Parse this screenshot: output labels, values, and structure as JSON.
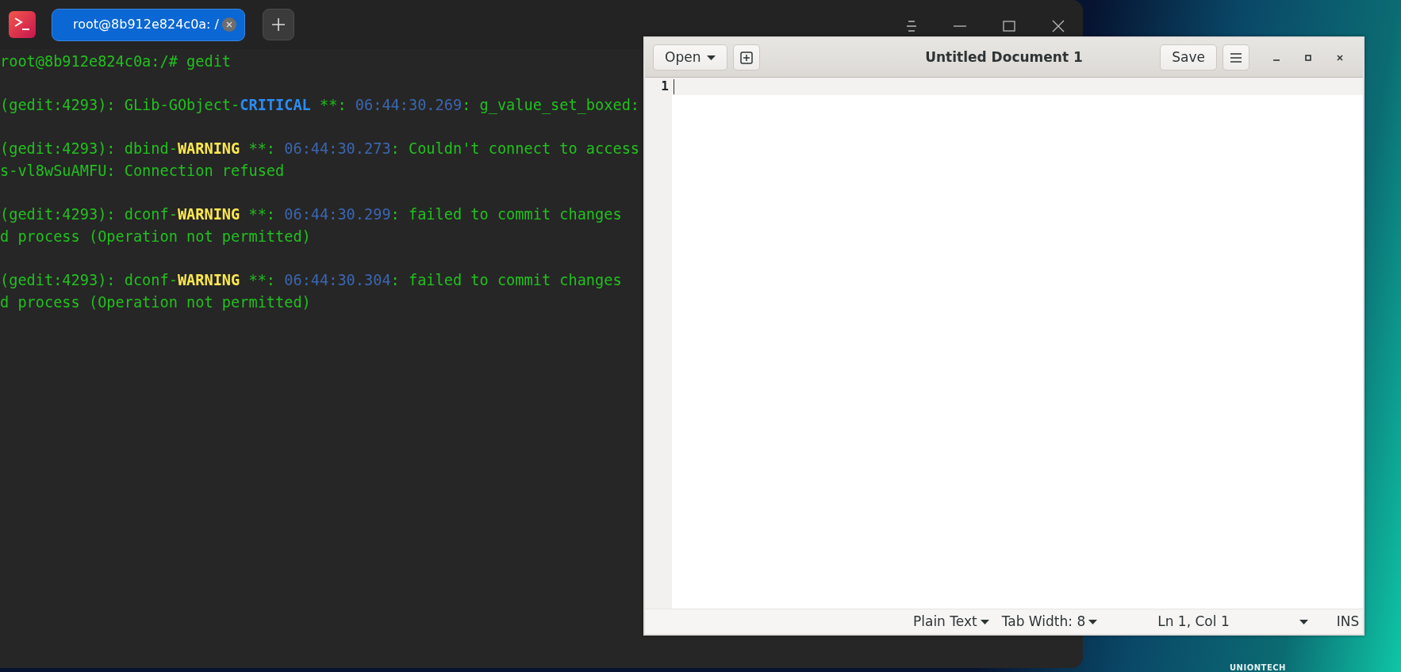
{
  "terminal": {
    "tab": {
      "label": "root@8b912e824c0a: /",
      "selected": true
    },
    "prompt": [
      {
        "text": "root@8b912e824c0a:/# gedit",
        "kind": "normal"
      }
    ],
    "messages": [
      {
        "lines": [
          [
            {
              "text": "(gedit:4293): GLib-GObject-",
              "kind": "normal"
            },
            {
              "text": "CRITICAL",
              "kind": "critical"
            },
            {
              "text": " **: ",
              "kind": "normal"
            },
            {
              "text": "06:44:30.269",
              "kind": "time"
            },
            {
              "text": ": g_value_set_boxed:",
              "kind": "normal"
            }
          ]
        ]
      },
      {
        "lines": [
          [
            {
              "text": "(gedit:4293): dbind-",
              "kind": "normal"
            },
            {
              "text": "WARNING",
              "kind": "warning"
            },
            {
              "text": " **: ",
              "kind": "normal"
            },
            {
              "text": "06:44:30.273",
              "kind": "time"
            },
            {
              "text": ": Couldn't connect to access",
              "kind": "normal"
            }
          ],
          [
            {
              "text": "s-vl8wSuAMFU: Connection refused",
              "kind": "normal"
            }
          ]
        ]
      },
      {
        "lines": [
          [
            {
              "text": "(gedit:4293): dconf-",
              "kind": "normal"
            },
            {
              "text": "WARNING",
              "kind": "warning"
            },
            {
              "text": " **: ",
              "kind": "normal"
            },
            {
              "text": "06:44:30.299",
              "kind": "time"
            },
            {
              "text": ": failed to commit changes",
              "kind": "normal"
            }
          ],
          [
            {
              "text": "d process (Operation not permitted)",
              "kind": "normal"
            }
          ]
        ]
      },
      {
        "lines": [
          [
            {
              "text": "(gedit:4293): dconf-",
              "kind": "normal"
            },
            {
              "text": "WARNING",
              "kind": "warning"
            },
            {
              "text": " **: ",
              "kind": "normal"
            },
            {
              "text": "06:44:30.304",
              "kind": "time"
            },
            {
              "text": ": failed to commit changes",
              "kind": "normal"
            }
          ],
          [
            {
              "text": "d process (Operation not permitted)",
              "kind": "normal"
            }
          ]
        ]
      }
    ]
  },
  "gedit": {
    "open_button": "Open",
    "title": "Untitled Document 1",
    "save_button": "Save",
    "line_numbers": [
      "1"
    ],
    "status_bar": {
      "language": "Plain Text",
      "tab_width": "Tab Width: 8",
      "position": "Ln 1, Col 1",
      "mode": "INS"
    }
  },
  "desktop": {
    "logo_text": "UNIONTECH"
  }
}
